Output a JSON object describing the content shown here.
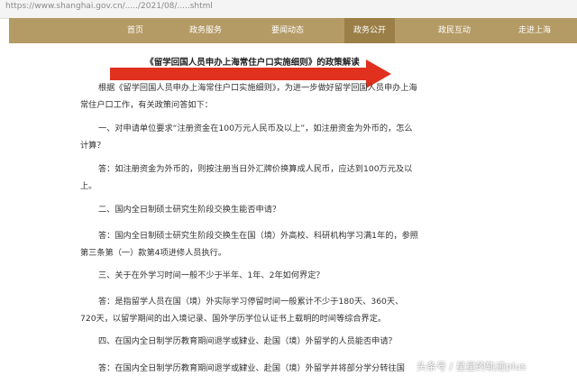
{
  "browser": {
    "url": "https://www.shanghai.gov.cn/...../2021/08/.....shtml"
  },
  "nav": {
    "items": [
      "首页",
      "政务服务",
      "要闻动态",
      "政务公开",
      "政民互动",
      "走进上海"
    ],
    "active_index": 3
  },
  "article": {
    "title": "《留学回国人员申办上海常住户口实施细则》的政策解读",
    "paragraphs": [
      "根据《留学回国人员申办上海常住户口实施细则》，为进一步做好留学回国人员申办上海常住户口工作，有关政策问答如下：",
      "一、对申请单位要求“注册资金在100万元人民币及以上”，如注册资金为外币的，怎么计算？",
      "答：如注册资金为外币的，则按注册当日外汇牌价换算成人民币，应达到100万元及以上。",
      "二、国内全日制硕士研究生阶段交换生能否申请？",
      "答：国内全日制硕士研究生阶段交换生在国（境）外高校、科研机构学习满1年的，参照第三条第（一）款第4项进修人员执行。",
      "三、关于在外学习时间一般不少于半年、1年、2年如何界定？",
      "答：是指留学人员在国（境）外实际学习停留时间一般累计不少于180天、360天、720天，以留学期间的出入境记录、国外学历学位认证书上载明的时间等综合界定。",
      "四、在国内全日制学历教育期间退学或肄业、赴国（境）外留学的人员能否申请？",
      "答：在国内全日制学历教育期间退学或肄业、赴国（境）外留学并将部分学分转往国"
    ]
  },
  "watermark": "头条号 / 星星的轨迹plus",
  "colors": {
    "nav_bg": "#b49a64",
    "nav_active": "#9b7f47",
    "arrow": "#e0301e",
    "text": "#333333"
  }
}
